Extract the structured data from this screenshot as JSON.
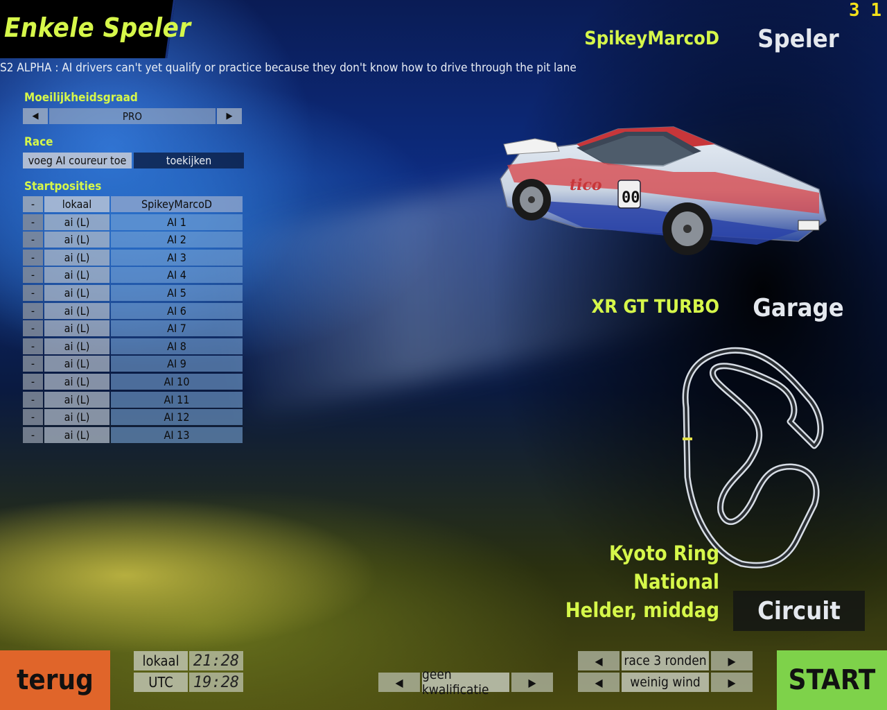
{
  "title": "Enkele Speler",
  "frame_counter": "3 1",
  "notice": "S2 ALPHA : AI drivers can't yet qualify or practice because they don't know how to drive through the pit lane",
  "difficulty": {
    "label": "Moeilijkheidsgraad",
    "value": "PRO"
  },
  "race": {
    "label": "Race",
    "add_ai": "voeg AI coureur toe",
    "watch": "toekijken"
  },
  "grid": {
    "label": "Startposities",
    "header": {
      "remove": "-",
      "type": "lokaal",
      "name": "SpikeyMarcoD"
    },
    "rows": [
      {
        "remove": "-",
        "type": "ai (L)",
        "name": "AI 1"
      },
      {
        "remove": "-",
        "type": "ai (L)",
        "name": "AI 2"
      },
      {
        "remove": "-",
        "type": "ai (L)",
        "name": "AI 3"
      },
      {
        "remove": "-",
        "type": "ai (L)",
        "name": "AI 4"
      },
      {
        "remove": "-",
        "type": "ai (L)",
        "name": "AI 5"
      },
      {
        "remove": "-",
        "type": "ai (L)",
        "name": "AI 6"
      },
      {
        "remove": "-",
        "type": "ai (L)",
        "name": "AI 7"
      },
      {
        "remove": "-",
        "type": "ai (L)",
        "name": "AI 8"
      },
      {
        "remove": "-",
        "type": "ai (L)",
        "name": "AI 9"
      },
      {
        "remove": "-",
        "type": "ai (L)",
        "name": "AI 10"
      },
      {
        "remove": "-",
        "type": "ai (L)",
        "name": "AI 11"
      },
      {
        "remove": "-",
        "type": "ai (L)",
        "name": "AI 12"
      },
      {
        "remove": "-",
        "type": "ai (L)",
        "name": "AI 13"
      }
    ]
  },
  "player": {
    "name": "SpikeyMarcoD",
    "button": "Speler"
  },
  "car": {
    "name": "XR GT TURBO",
    "button": "Garage",
    "livery_text": "tico",
    "number": "00"
  },
  "track": {
    "name": "Kyoto Ring",
    "layout": "National",
    "weather": "Helder, middag",
    "button": "Circuit"
  },
  "bottom": {
    "back": "terug",
    "start": "START",
    "time_local_label": "lokaal",
    "time_local": "21:28",
    "time_utc_label": "UTC",
    "time_utc": "19:28",
    "qualify": "geen kwalificatie",
    "race_laps": "race 3 ronden",
    "wind": "weinig wind"
  },
  "colors": {
    "accent_yellow": "#d6f74a",
    "back_orange": "#e0652a",
    "start_green": "#7ed24a"
  }
}
